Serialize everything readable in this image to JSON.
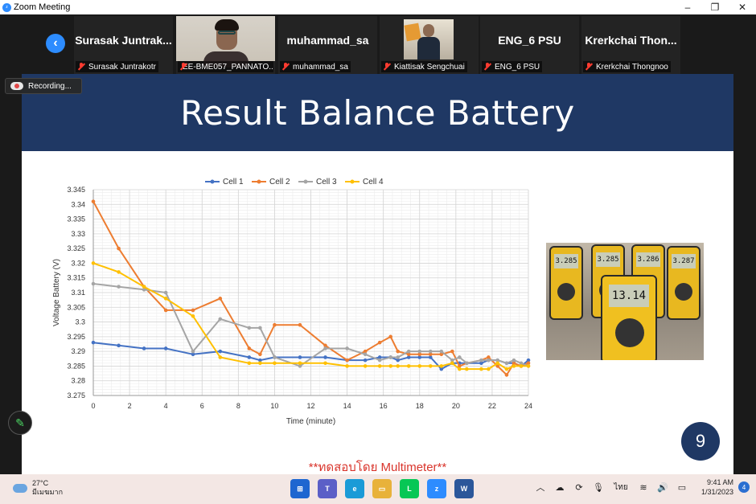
{
  "window": {
    "title": "Zoom Meeting"
  },
  "participants": [
    {
      "display_name": "Surasak  Juntrak...",
      "label": "Surasak Juntrakotr",
      "video": false
    },
    {
      "display_name": "",
      "label": "EE-BME057_PANNATO...",
      "video": true
    },
    {
      "display_name": "muhammad_sa",
      "label": "muhammad_sa",
      "video": false
    },
    {
      "display_name": "",
      "label": "Kiattisak Sengchuai",
      "video": true
    },
    {
      "display_name": "ENG_6 PSU",
      "label": "ENG_6 PSU",
      "video": false
    },
    {
      "display_name": "Krerkchai  Thon...",
      "label": "Krerkchai Thongnoo",
      "video": false
    }
  ],
  "recording": {
    "label": "Recording..."
  },
  "slide": {
    "title": "Result Balance Battery",
    "page_number": "9",
    "footnote": "**ทดสอบโดย Multimeter**",
    "meter_readings": [
      "3.285",
      "3.285",
      "3.286",
      "3.287",
      "13.14"
    ]
  },
  "chart_data": {
    "type": "line",
    "xlabel": "Time (minute)",
    "ylabel": "Voltage Battery (V)",
    "xlim": [
      0,
      24
    ],
    "ylim": [
      3.275,
      3.345
    ],
    "x_ticks": [
      0,
      2,
      4,
      6,
      8,
      10,
      12,
      14,
      16,
      18,
      20,
      22,
      24
    ],
    "y_ticks": [
      "3.275",
      "3.28",
      "3.285",
      "3.29",
      "3.295",
      "3.3",
      "3.305",
      "3.31",
      "3.315",
      "3.32",
      "3.325",
      "3.33",
      "3.335",
      "3.34",
      "3.345"
    ],
    "grid": true,
    "legend_position": "top",
    "series": [
      {
        "name": "Cell 1",
        "color": "#4472c4",
        "points": [
          [
            0,
            3.293
          ],
          [
            1.4,
            3.292
          ],
          [
            2.8,
            3.291
          ],
          [
            4,
            3.291
          ],
          [
            5.5,
            3.289
          ],
          [
            7,
            3.29
          ],
          [
            8.6,
            3.288
          ],
          [
            9.2,
            3.287
          ],
          [
            10,
            3.288
          ],
          [
            11.4,
            3.288
          ],
          [
            12.8,
            3.288
          ],
          [
            14,
            3.287
          ],
          [
            15,
            3.287
          ],
          [
            15.8,
            3.288
          ],
          [
            16.4,
            3.288
          ],
          [
            16.8,
            3.287
          ],
          [
            17.4,
            3.288
          ],
          [
            18,
            3.288
          ],
          [
            18.6,
            3.288
          ],
          [
            19.2,
            3.284
          ],
          [
            19.8,
            3.286
          ],
          [
            20.2,
            3.286
          ],
          [
            20.6,
            3.286
          ],
          [
            21.4,
            3.286
          ],
          [
            21.8,
            3.287
          ],
          [
            22.3,
            3.287
          ],
          [
            22.8,
            3.286
          ],
          [
            23.2,
            3.286
          ],
          [
            23.6,
            3.285
          ],
          [
            24,
            3.287
          ]
        ]
      },
      {
        "name": "Cell 2",
        "color": "#ed7d31",
        "points": [
          [
            0,
            3.341
          ],
          [
            1.4,
            3.325
          ],
          [
            2.8,
            3.312
          ],
          [
            4,
            3.304
          ],
          [
            5.5,
            3.304
          ],
          [
            7,
            3.308
          ],
          [
            8.6,
            3.291
          ],
          [
            9.2,
            3.289
          ],
          [
            10,
            3.299
          ],
          [
            11.4,
            3.299
          ],
          [
            12.8,
            3.292
          ],
          [
            14,
            3.287
          ],
          [
            15,
            3.29
          ],
          [
            15.8,
            3.293
          ],
          [
            16.4,
            3.295
          ],
          [
            16.8,
            3.29
          ],
          [
            17.4,
            3.289
          ],
          [
            18,
            3.289
          ],
          [
            18.6,
            3.289
          ],
          [
            19.2,
            3.289
          ],
          [
            19.8,
            3.29
          ],
          [
            20.2,
            3.285
          ],
          [
            20.6,
            3.286
          ],
          [
            21.4,
            3.287
          ],
          [
            21.8,
            3.288
          ],
          [
            22.3,
            3.285
          ],
          [
            22.8,
            3.282
          ],
          [
            23.2,
            3.286
          ],
          [
            23.6,
            3.285
          ],
          [
            24,
            3.286
          ]
        ]
      },
      {
        "name": "Cell 3",
        "color": "#a5a5a5",
        "points": [
          [
            0,
            3.313
          ],
          [
            1.4,
            3.312
          ],
          [
            2.8,
            3.311
          ],
          [
            4,
            3.31
          ],
          [
            5.5,
            3.29
          ],
          [
            7,
            3.301
          ],
          [
            8.6,
            3.298
          ],
          [
            9.2,
            3.298
          ],
          [
            10,
            3.288
          ],
          [
            11.4,
            3.285
          ],
          [
            12.8,
            3.291
          ],
          [
            14,
            3.291
          ],
          [
            15,
            3.289
          ],
          [
            15.8,
            3.287
          ],
          [
            16.4,
            3.288
          ],
          [
            16.8,
            3.288
          ],
          [
            17.4,
            3.29
          ],
          [
            18,
            3.29
          ],
          [
            18.6,
            3.29
          ],
          [
            19.2,
            3.29
          ],
          [
            19.8,
            3.287
          ],
          [
            20.2,
            3.288
          ],
          [
            20.6,
            3.286
          ],
          [
            21.4,
            3.287
          ],
          [
            21.8,
            3.287
          ],
          [
            22.3,
            3.287
          ],
          [
            22.8,
            3.286
          ],
          [
            23.2,
            3.287
          ],
          [
            23.6,
            3.286
          ],
          [
            24,
            3.285
          ]
        ]
      },
      {
        "name": "Cell 4",
        "color": "#ffc000",
        "points": [
          [
            0,
            3.32
          ],
          [
            1.4,
            3.317
          ],
          [
            2.8,
            3.312
          ],
          [
            4,
            3.308
          ],
          [
            5.5,
            3.302
          ],
          [
            7,
            3.288
          ],
          [
            8.6,
            3.286
          ],
          [
            9.2,
            3.286
          ],
          [
            10,
            3.286
          ],
          [
            11.4,
            3.286
          ],
          [
            12.8,
            3.286
          ],
          [
            14,
            3.285
          ],
          [
            15,
            3.285
          ],
          [
            15.8,
            3.285
          ],
          [
            16.4,
            3.285
          ],
          [
            16.8,
            3.285
          ],
          [
            17.4,
            3.285
          ],
          [
            18,
            3.285
          ],
          [
            18.6,
            3.285
          ],
          [
            19.2,
            3.285
          ],
          [
            19.8,
            3.286
          ],
          [
            20.2,
            3.284
          ],
          [
            20.6,
            3.284
          ],
          [
            21.4,
            3.284
          ],
          [
            21.8,
            3.284
          ],
          [
            22.3,
            3.286
          ],
          [
            22.8,
            3.284
          ],
          [
            23.2,
            3.285
          ],
          [
            23.6,
            3.285
          ],
          [
            24,
            3.285
          ]
        ]
      }
    ]
  },
  "taskbar": {
    "weather_temp": "27°C",
    "weather_desc": "มีเมฆมาก",
    "language": "ไทย",
    "time": "9:41 AM",
    "date": "1/31/2023",
    "notification_count": "4",
    "apps": [
      {
        "name": "start",
        "color": "#1e66d0",
        "glyph": "⊞"
      },
      {
        "name": "teams",
        "color": "#5b5fc7",
        "glyph": "T"
      },
      {
        "name": "edge",
        "color": "#1a9bd7",
        "glyph": "e"
      },
      {
        "name": "file-explorer",
        "color": "#e8b23a",
        "glyph": "▭"
      },
      {
        "name": "line",
        "color": "#06c755",
        "glyph": "L"
      },
      {
        "name": "zoom",
        "color": "#2d8cff",
        "glyph": "z"
      },
      {
        "name": "word",
        "color": "#2b579a",
        "glyph": "W"
      }
    ]
  }
}
